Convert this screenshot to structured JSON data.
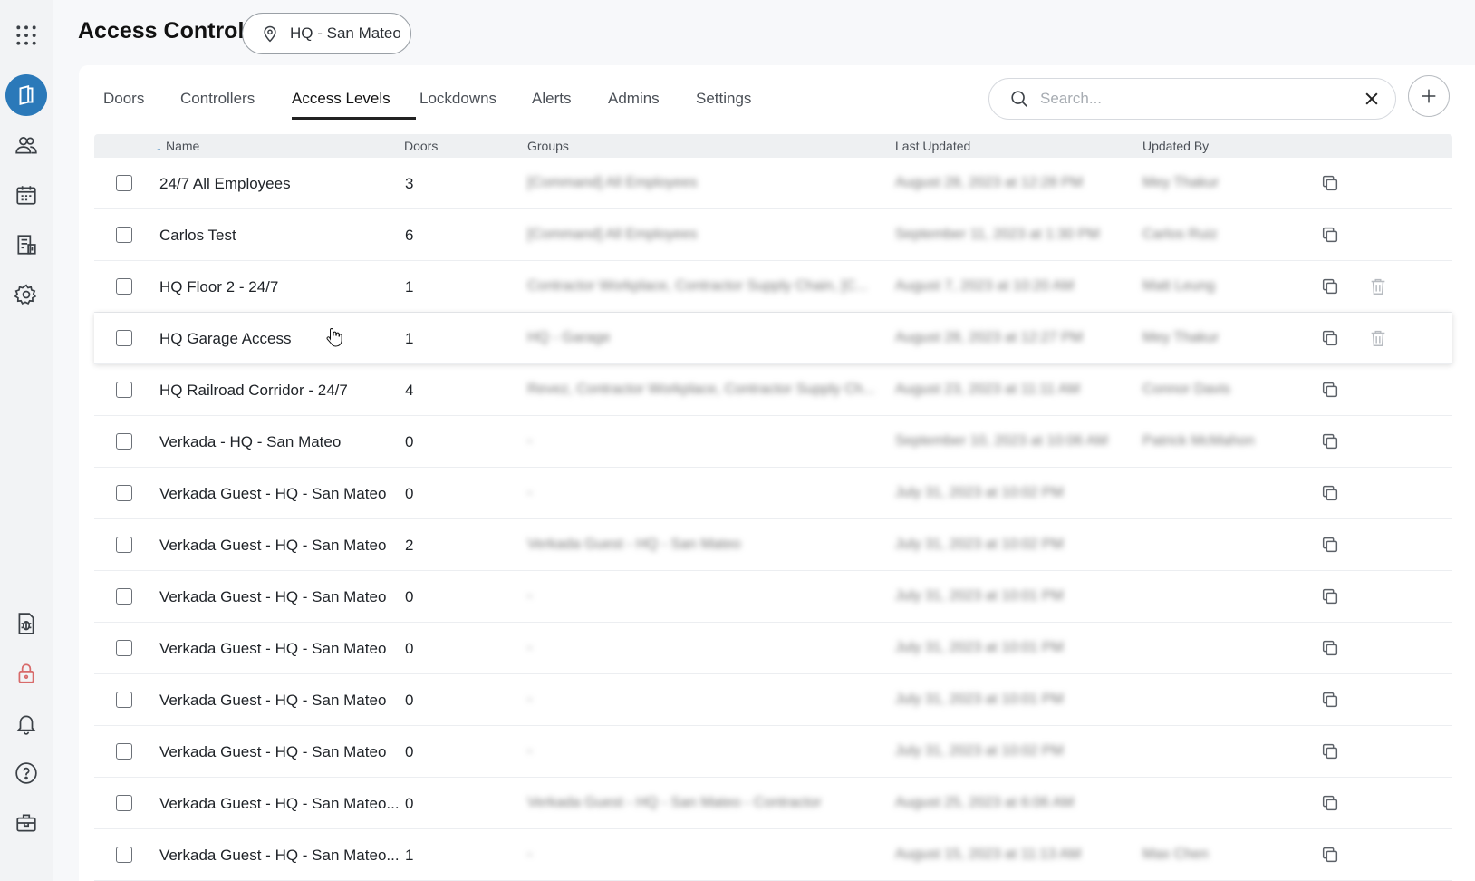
{
  "header": {
    "title": "Access Control",
    "site": "HQ - San Mateo"
  },
  "sidebar": {
    "icons": [
      "apps-grid-icon",
      "access-card-icon",
      "users-icon",
      "calendar-icon",
      "reports-icon",
      "settings-icon",
      "bug-report-icon",
      "lock-icon",
      "bell-icon",
      "help-icon",
      "toolbox-icon"
    ]
  },
  "tabs": [
    {
      "label": "Doors"
    },
    {
      "label": "Controllers"
    },
    {
      "label": "Access Levels",
      "active": true
    },
    {
      "label": "Lockdowns"
    },
    {
      "label": "Alerts"
    },
    {
      "label": "Admins"
    },
    {
      "label": "Settings"
    }
  ],
  "search": {
    "placeholder": "Search..."
  },
  "table": {
    "columns": {
      "name": "Name",
      "doors": "Doors",
      "groups": "Groups",
      "last_updated": "Last Updated",
      "updated_by": "Updated By"
    },
    "rows": [
      {
        "name": "24/7 All Employees",
        "doors": "3",
        "groups": "[Command] All Employees",
        "updated": "August 28, 2023 at 12:28 PM",
        "by": "Mey Thakur",
        "deletable": false
      },
      {
        "name": "Carlos Test",
        "doors": "6",
        "groups": "[Command] All Employees",
        "updated": "September 11, 2023 at 1:30 PM",
        "by": "Carlos Ruiz",
        "deletable": false
      },
      {
        "name": "HQ Floor 2 - 24/7",
        "doors": "1",
        "groups": "Contractor Workplace, Contractor Supply Chain, [C...",
        "updated": "August 7, 2023 at 10:20 AM",
        "by": "Matt Leung",
        "deletable": true
      },
      {
        "name": "HQ Garage Access",
        "doors": "1",
        "groups": "HQ - Garage",
        "updated": "August 28, 2023 at 12:27 PM",
        "by": "Mey Thakur",
        "deletable": true,
        "hover": true
      },
      {
        "name": "HQ Railroad Corridor - 24/7",
        "doors": "4",
        "groups": "Revez, Contractor Workplace, Contractor Supply Ch...",
        "updated": "August 23, 2023 at 11:11 AM",
        "by": "Connor Davis",
        "deletable": false
      },
      {
        "name": "Verkada - HQ - San Mateo",
        "doors": "0",
        "groups": "-",
        "updated": "September 10, 2023 at 10:06 AM",
        "by": "Patrick McMahon",
        "deletable": false
      },
      {
        "name": "Verkada Guest - HQ - San Mateo",
        "doors": "0",
        "groups": "-",
        "updated": "July 31, 2023 at 10:02 PM",
        "by": "",
        "deletable": false
      },
      {
        "name": "Verkada Guest - HQ - San Mateo",
        "doors": "2",
        "groups": "Verkada Guest - HQ - San Mateo",
        "updated": "July 31, 2023 at 10:02 PM",
        "by": "",
        "deletable": false
      },
      {
        "name": "Verkada Guest - HQ - San Mateo",
        "doors": "0",
        "groups": "-",
        "updated": "July 31, 2023 at 10:01 PM",
        "by": "",
        "deletable": false
      },
      {
        "name": "Verkada Guest - HQ - San Mateo",
        "doors": "0",
        "groups": "-",
        "updated": "July 31, 2023 at 10:01 PM",
        "by": "",
        "deletable": false
      },
      {
        "name": "Verkada Guest - HQ - San Mateo",
        "doors": "0",
        "groups": "-",
        "updated": "July 31, 2023 at 10:01 PM",
        "by": "",
        "deletable": false
      },
      {
        "name": "Verkada Guest - HQ - San Mateo",
        "doors": "0",
        "groups": "-",
        "updated": "July 31, 2023 at 10:02 PM",
        "by": "",
        "deletable": false
      },
      {
        "name": "Verkada Guest - HQ - San Mateo...",
        "doors": "0",
        "groups": "Verkada Guest - HQ - San Mateo - Contractor",
        "updated": "August 25, 2023 at 6:06 AM",
        "by": "",
        "deletable": false
      },
      {
        "name": "Verkada Guest - HQ - San Mateo...",
        "doors": "1",
        "groups": "-",
        "updated": "August 15, 2023 at 11:13 AM",
        "by": "Max Chen",
        "deletable": false
      }
    ]
  },
  "colors": {
    "accent": "#2b79b9",
    "lock": "#d86a6a"
  }
}
